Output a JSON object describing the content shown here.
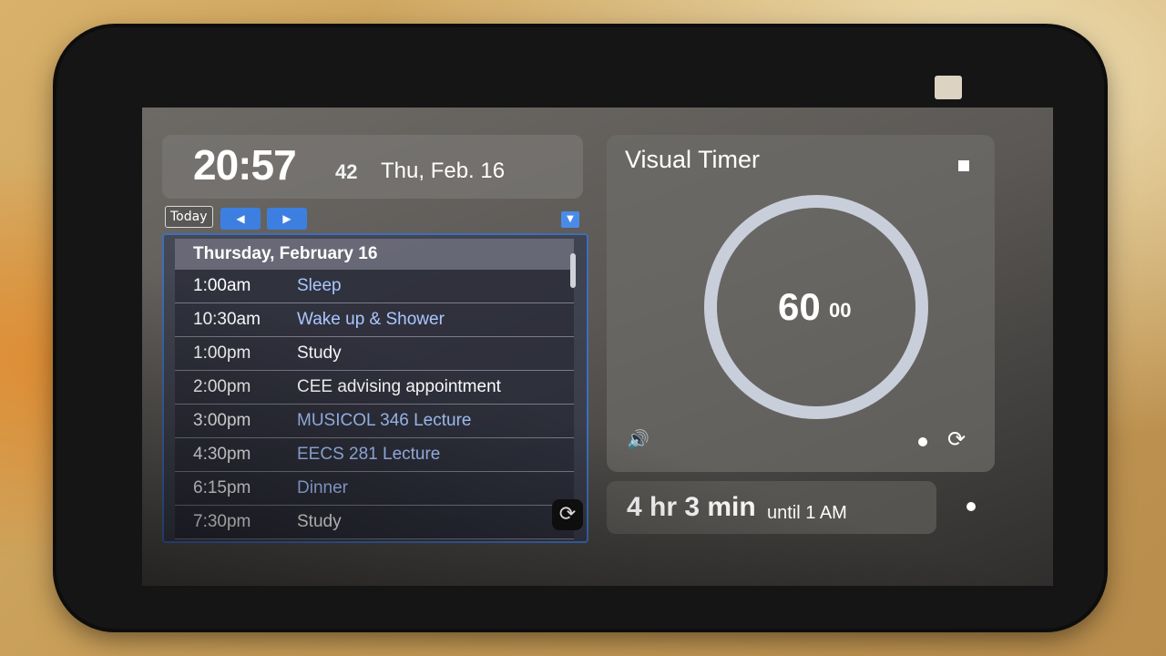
{
  "clock": {
    "time": "20:57",
    "seconds": "42",
    "date": "Thu, Feb. 16"
  },
  "calendar": {
    "today_label": "Today",
    "prev_icon": "◀",
    "next_icon": "▶",
    "menu_icon": "▼",
    "day_header": "Thursday, February 16",
    "events": [
      {
        "time": "1:00am",
        "title": "Sleep",
        "link": true
      },
      {
        "time": "10:30am",
        "title": "Wake up & Shower",
        "link": true
      },
      {
        "time": "1:00pm",
        "title": "Study",
        "link": false
      },
      {
        "time": "2:00pm",
        "title": "CEE advising appointment",
        "link": false
      },
      {
        "time": "3:00pm",
        "title": "MUSICOL 346 Lecture",
        "link": true
      },
      {
        "time": "4:30pm",
        "title": "EECS 281 Lecture",
        "link": true
      },
      {
        "time": "6:15pm",
        "title": "Dinner",
        "link": true
      },
      {
        "time": "7:30pm",
        "title": "Study",
        "link": false
      }
    ],
    "refresh_icon": "⟳"
  },
  "timer": {
    "title": "Visual Timer",
    "minutes": "60",
    "seconds": "00",
    "volume_icon": "🔊",
    "reset_icon": "⟳"
  },
  "countdown": {
    "main": "4 hr 3 min",
    "sub": "until 1 AM"
  },
  "colors": {
    "accent_blue": "#3d7fe0",
    "link_blue": "#a9c7ff"
  }
}
